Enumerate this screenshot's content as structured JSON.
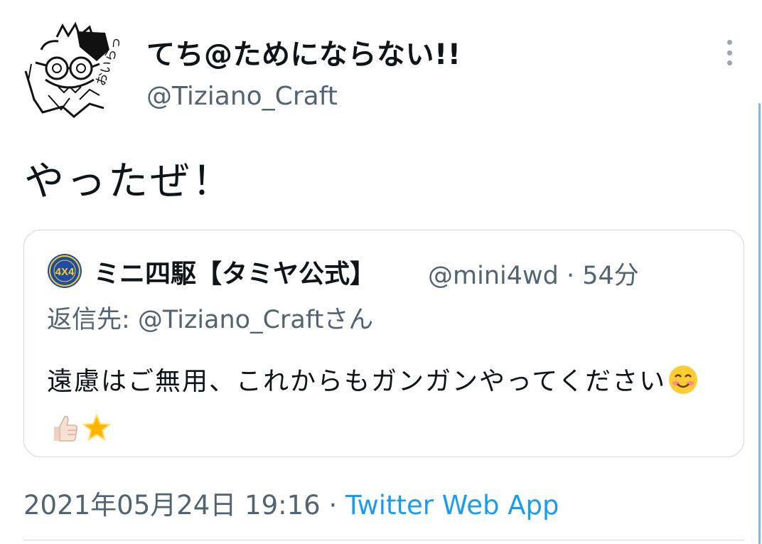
{
  "tweet": {
    "author": {
      "display_name": "てち@ためにならない!!",
      "handle": "@Tiziano_Craft",
      "avatar_text": "おいらっ"
    },
    "text": "やったぜ！",
    "timestamp": "2021年05月24日 19:16",
    "separator": "·",
    "source": "Twitter Web App",
    "more_icon": "more-vertical-icon"
  },
  "quote": {
    "display_name": "ミニ四駆【タミヤ公式】",
    "handle_time": "@mini4wd · 54分",
    "reply_to": "返信先: @Tiziano_Craftさん",
    "body_text": "遠慮はご無用、これからもガンガンやってください",
    "avatar_logo_text": "4X4",
    "emojis": [
      "smiling-face-emoji",
      "thumbs-up-emoji",
      "star-emoji"
    ]
  },
  "colors": {
    "text": "#0f1419",
    "secondary": "#536471",
    "link": "#1d9bf0",
    "border": "#cfd9de"
  }
}
